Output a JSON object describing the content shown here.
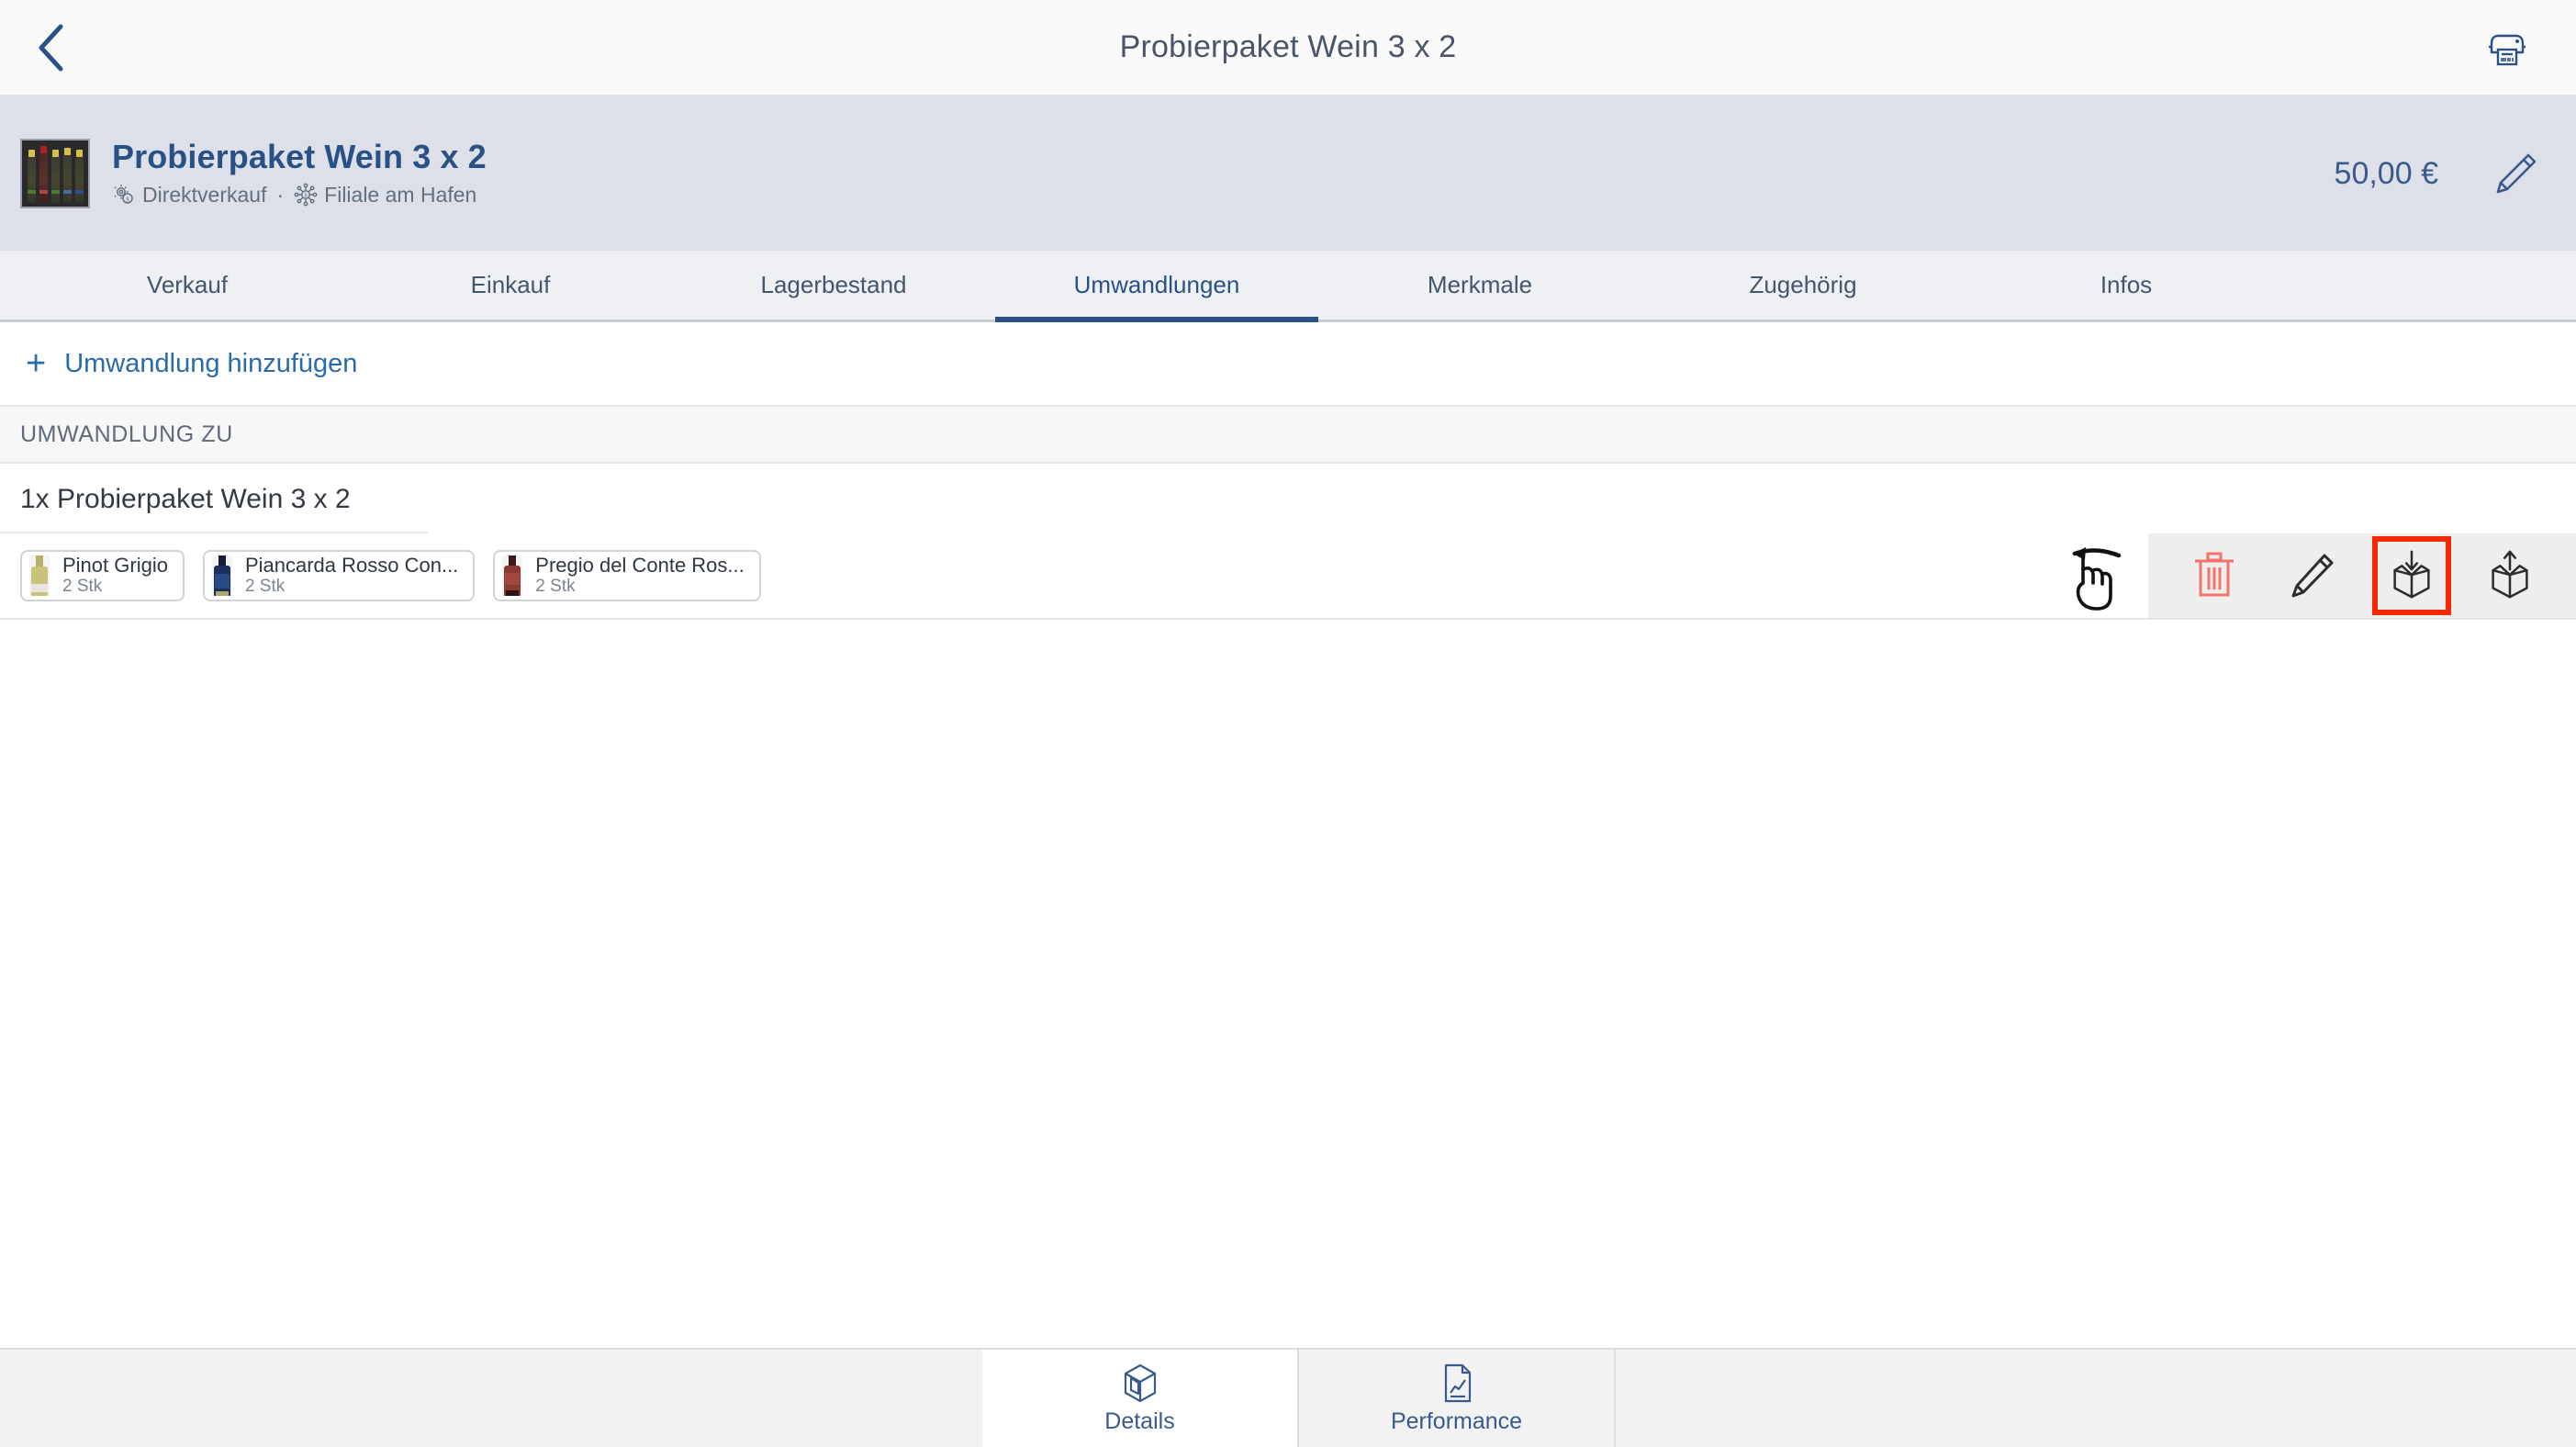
{
  "topbar": {
    "back_icon": "chevron-left-icon",
    "title": "Probierpaket Wein 3 x 2",
    "print_icon": "printer-icon"
  },
  "object_header": {
    "thumbnail_alt": "wine-bottles-photo",
    "title": "Probierpaket Wein 3 x 2",
    "sales_channel_icon": "gear-coin-icon",
    "sales_channel": "Direktverkauf",
    "separator": "·",
    "location_icon": "network-hub-icon",
    "location": "Filiale am Hafen",
    "price": "50,00 €",
    "edit_icon": "pencil-icon"
  },
  "tabs": {
    "items": [
      {
        "label": "Verkauf",
        "active": false
      },
      {
        "label": "Einkauf",
        "active": false
      },
      {
        "label": "Lagerbestand",
        "active": false
      },
      {
        "label": "Umwandlungen",
        "active": true
      },
      {
        "label": "Merkmale",
        "active": false
      },
      {
        "label": "Zugehörig",
        "active": false
      },
      {
        "label": "Infos",
        "active": false
      }
    ]
  },
  "add_row": {
    "plus": "+",
    "label": "Umwandlung hinzufügen",
    "icon": "plus-icon"
  },
  "section": {
    "header": "UMWANDLUNG ZU"
  },
  "conversion": {
    "title": "1x Probierpaket Wein 3 x 2",
    "components": [
      {
        "name": "Pinot Grigio",
        "qty": "2 Stk",
        "bottle_color": "#c9c27a",
        "cap_color": "#d9d07e"
      },
      {
        "name": "Piancarda Rosso Con...",
        "qty": "2 Stk",
        "bottle_color": "#1b2f5c",
        "cap_color": "#12203f"
      },
      {
        "name": "Pregio del Conte Ros...",
        "qty": "2 Stk",
        "bottle_color": "#8a3a32",
        "cap_color": "#6e2c25"
      }
    ],
    "gesture_hint_icon": "swipe-left-hand-icon",
    "actions": [
      {
        "icon": "trash-icon",
        "name": "delete",
        "highlighted": false,
        "color": "#f3736b"
      },
      {
        "icon": "pencil-icon",
        "name": "edit",
        "highlighted": false,
        "color": "#2d2d2d"
      },
      {
        "icon": "box-arrow-down-icon",
        "name": "pack",
        "highlighted": true,
        "color": "#2d2d2d"
      },
      {
        "icon": "box-arrow-up-icon",
        "name": "unpack",
        "highlighted": false,
        "color": "#2d2d2d"
      }
    ]
  },
  "bottom_nav": {
    "items": [
      {
        "label": "Details",
        "icon": "cube-icon",
        "active": true
      },
      {
        "label": "Performance",
        "icon": "chart-document-icon",
        "active": false
      }
    ]
  },
  "colors": {
    "accent_blue": "#2a5186",
    "link_blue": "#2a6aa8",
    "header_bg": "#dde0e8",
    "highlight_red": "#f42a05",
    "trash_red": "#f3736b"
  }
}
